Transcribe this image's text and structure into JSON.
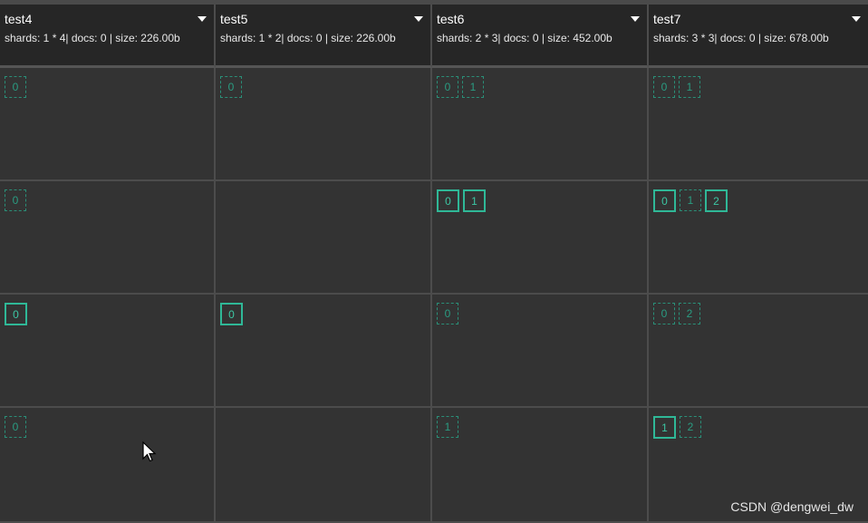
{
  "indices": [
    {
      "name": "test4",
      "stats": "shards: 1 * 4| docs: 0 | size: 226.00b"
    },
    {
      "name": "test5",
      "stats": "shards: 1 * 2| docs: 0 | size: 226.00b"
    },
    {
      "name": "test6",
      "stats": "shards: 2 * 3| docs: 0 | size: 452.00b"
    },
    {
      "name": "test7",
      "stats": "shards: 3 * 3| docs: 0 | size: 678.00b"
    }
  ],
  "rows": [
    [
      [
        {
          "id": "0",
          "kind": "replica"
        }
      ],
      [
        {
          "id": "0",
          "kind": "replica"
        }
      ],
      [
        {
          "id": "0",
          "kind": "replica"
        },
        {
          "id": "1",
          "kind": "replica"
        }
      ],
      [
        {
          "id": "0",
          "kind": "replica"
        },
        {
          "id": "1",
          "kind": "replica"
        }
      ]
    ],
    [
      [
        {
          "id": "0",
          "kind": "replica"
        }
      ],
      [],
      [
        {
          "id": "0",
          "kind": "primary"
        },
        {
          "id": "1",
          "kind": "primary"
        }
      ],
      [
        {
          "id": "0",
          "kind": "primary"
        },
        {
          "id": "1",
          "kind": "replica"
        },
        {
          "id": "2",
          "kind": "primary"
        }
      ]
    ],
    [
      [
        {
          "id": "0",
          "kind": "primary"
        }
      ],
      [
        {
          "id": "0",
          "kind": "primary"
        }
      ],
      [
        {
          "id": "0",
          "kind": "replica"
        }
      ],
      [
        {
          "id": "0",
          "kind": "replica"
        },
        {
          "id": "2",
          "kind": "replica"
        }
      ]
    ],
    [
      [
        {
          "id": "0",
          "kind": "replica"
        }
      ],
      [],
      [
        {
          "id": "1",
          "kind": "replica"
        }
      ],
      [
        {
          "id": "1",
          "kind": "primary"
        },
        {
          "id": "2",
          "kind": "replica"
        }
      ]
    ]
  ],
  "colors": {
    "primary": "#2fb897",
    "replica": "#2a8f78",
    "background": "#333333",
    "header_background": "#262626"
  },
  "watermark": "CSDN @dengwei_dw"
}
